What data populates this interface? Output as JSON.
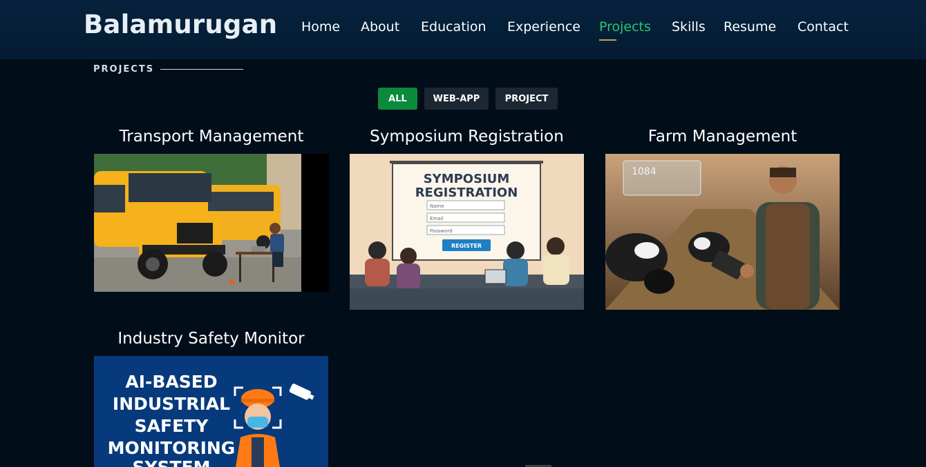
{
  "header": {
    "brand": "Balamurugan",
    "nav": [
      "Home",
      "About",
      "Education",
      "Experience",
      "Projects",
      "Skills",
      "Resume",
      "Contact"
    ],
    "active_nav": "Projects",
    "active_color": "#28c76f"
  },
  "section": {
    "title": "PROJECTS"
  },
  "filters": [
    "ALL",
    "WEB-APP",
    "PROJECT"
  ],
  "projects": [
    {
      "title": "Transport Management"
    },
    {
      "title": "Symposium Registration",
      "image_text": {
        "heading_1": "SYMPOSIUM",
        "heading_2": "REGISTRATION",
        "field_1": "Name",
        "field_2": "Email",
        "field_3": "Password",
        "button": "REGISTER"
      }
    },
    {
      "title": "Farm Management",
      "image_text": {
        "counter": "1084"
      }
    },
    {
      "title": "Industry Safety Monitor",
      "image_text": {
        "line_1": "AI-BASED",
        "line_2": "INDUSTRIAL",
        "line_3": "SAFETY",
        "line_4": "MONITORING",
        "line_5": "SYSTEM"
      }
    }
  ]
}
